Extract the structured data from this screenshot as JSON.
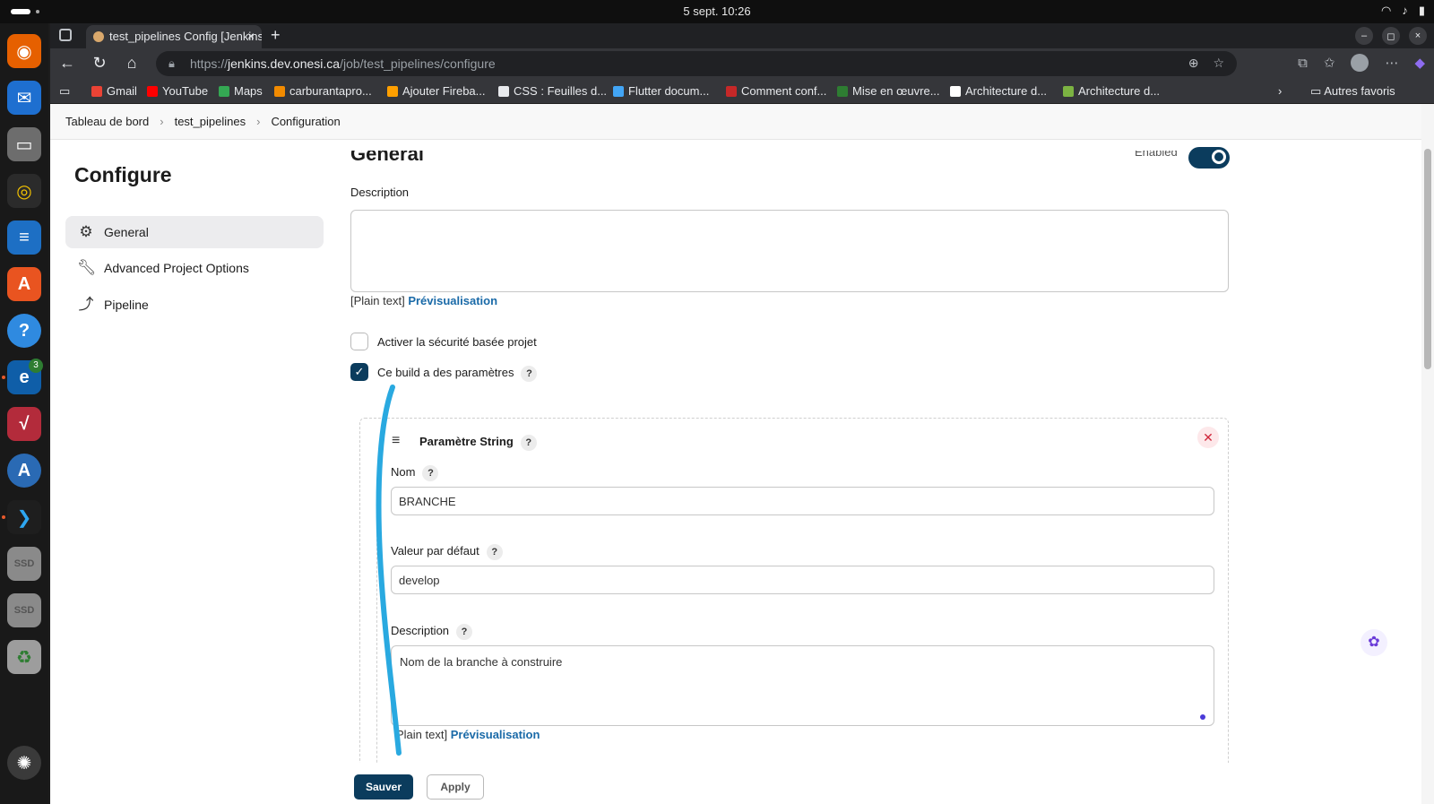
{
  "system": {
    "clock": "5 sept.  10:26",
    "tray_icons": [
      "wifi-icon",
      "volume-icon",
      "battery-icon"
    ]
  },
  "dock": {
    "apps": [
      "firefox",
      "thunderbird",
      "files",
      "rhythmbox",
      "libreoffice-writer",
      "app-center",
      "help",
      "edge",
      "math",
      "a-app",
      "vscode",
      "ssd-drive",
      "ssd-drive",
      "trash",
      "ubuntu"
    ],
    "edge_badge": "3",
    "ssd_label": "SSD"
  },
  "browser": {
    "tab_title": "test_pipelines Config [Jenkins]",
    "url_scheme": "https://",
    "url_host": "jenkins.dev.onesi.ca",
    "url_path": "/job/test_pipelines/configure",
    "bookmarks": [
      {
        "label": "Gmail",
        "color": "#ea4335"
      },
      {
        "label": "YouTube",
        "color": "#ff0000"
      },
      {
        "label": "Maps",
        "color": "#34a853"
      },
      {
        "label": "carburantapro...",
        "color": "#f28b00"
      },
      {
        "label": "Ajouter Fireba...",
        "color": "#ffa000"
      },
      {
        "label": "CSS : Feuilles d...",
        "color": "#e8eaed"
      },
      {
        "label": "Flutter docum...",
        "color": "#42a5f5"
      },
      {
        "label": "Comment conf...",
        "color": "#c62828"
      },
      {
        "label": "Mise en œuvre...",
        "color": "#2e7d32"
      },
      {
        "label": "Architecture d...",
        "color": "#ffffff"
      },
      {
        "label": "Architecture d...",
        "color": "#7cb342"
      }
    ],
    "other_bookmarks": "Autres favoris"
  },
  "breadcrumb": {
    "items": [
      "Tableau de bord",
      "test_pipelines",
      "Configuration"
    ]
  },
  "sidebar": {
    "title": "Configure",
    "items": [
      {
        "label": "General",
        "active": true
      },
      {
        "label": "Advanced Project Options",
        "active": false
      },
      {
        "label": "Pipeline",
        "active": false
      }
    ]
  },
  "general": {
    "heading": "General",
    "enabled_label": "Enabled",
    "description_label": "Description",
    "description_value": "",
    "plain_text": "[Plain text]",
    "preview_link": "Prévisualisation",
    "project_security_label": "Activer la sécurité basée projet",
    "parameterized_label": "Ce build a des paramètres"
  },
  "string_param": {
    "title": "Paramètre String",
    "name_label": "Nom",
    "name_value": "BRANCHE",
    "default_label": "Valeur par défaut",
    "default_value": "develop",
    "description_label": "Description",
    "description_value": "Nom de la branche à construire",
    "plain_text": "Plain text]",
    "preview_link": "Prévisualisation"
  },
  "actions": {
    "save": "Sauver",
    "apply": "Apply"
  },
  "help_glyph": "?",
  "colors": {
    "jenkins_primary": "#0b3c5d",
    "link": "#1a6aa8",
    "annotation_stroke": "#29a9e0"
  }
}
